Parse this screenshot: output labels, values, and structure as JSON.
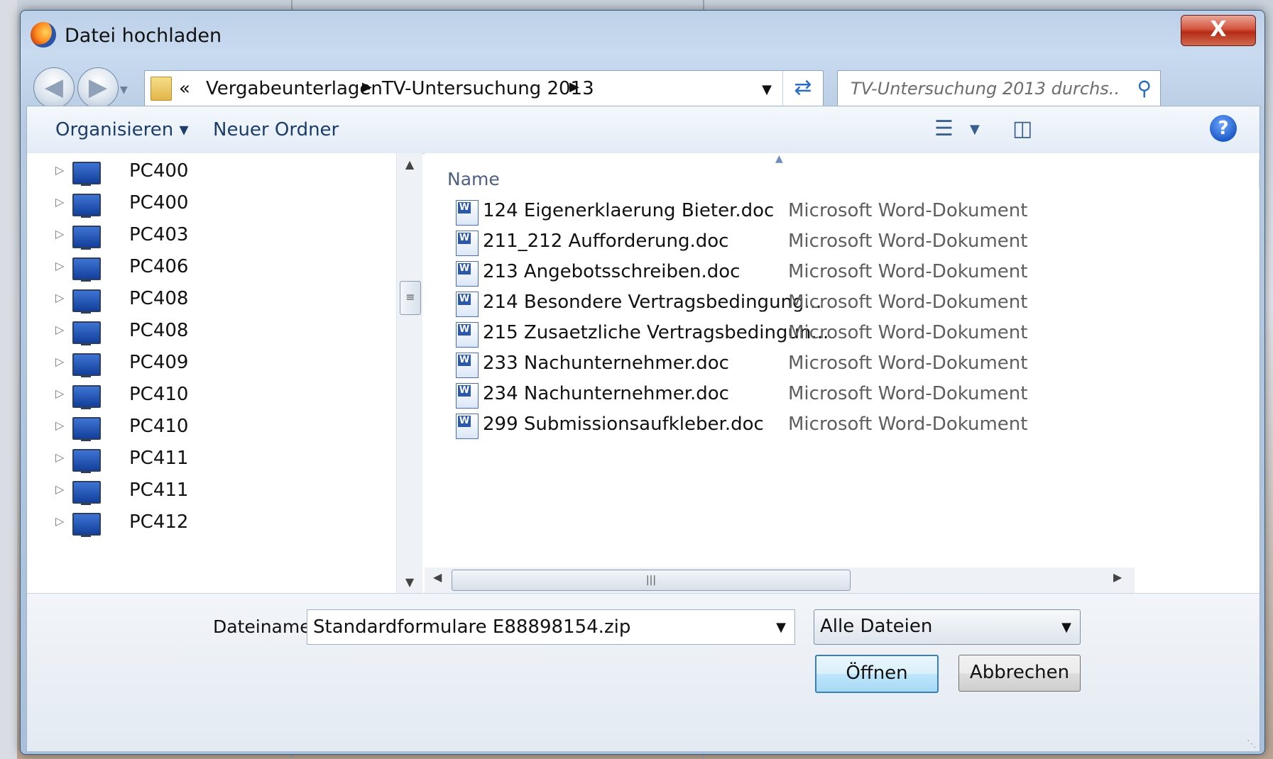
{
  "window": {
    "title": "Datei hochladen",
    "close_label": "X"
  },
  "navigation": {
    "back_icon": "back-arrow-icon",
    "forward_icon": "forward-arrow-icon",
    "overflow": "«",
    "breadcrumb": [
      "Vergabeunterlagen",
      "TV-Untersuchung 2013"
    ],
    "search_placeholder": "TV-Untersuchung 2013 durchs..."
  },
  "toolbar": {
    "organize_label": "Organisieren ▾",
    "new_folder_label": "Neuer Ordner"
  },
  "tree": {
    "items": [
      "PC400",
      "PC400",
      "PC403",
      "PC406",
      "PC408",
      "PC408",
      "PC409",
      "PC410",
      "PC410",
      "PC411",
      "PC411",
      "PC412"
    ]
  },
  "filelist": {
    "column_name": "Name",
    "files": [
      {
        "name": "124 Eigenerklaerung Bieter.doc",
        "type": "Microsoft Word-Dokument"
      },
      {
        "name": "211_212 Aufforderung.doc",
        "type": "Microsoft Word-Dokument"
      },
      {
        "name": "213 Angebotsschreiben.doc",
        "type": "Microsoft Word-Dokument"
      },
      {
        "name": "214 Besondere Vertragsbedingung...",
        "type": "Microsoft Word-Dokument"
      },
      {
        "name": "215 Zusaetzliche Vertragsbedingun...",
        "type": "Microsoft Word-Dokument"
      },
      {
        "name": "233 Nachunternehmer.doc",
        "type": "Microsoft Word-Dokument"
      },
      {
        "name": "234 Nachunternehmer.doc",
        "type": "Microsoft Word-Dokument"
      },
      {
        "name": "299 Submissionsaufkleber.doc",
        "type": "Microsoft Word-Dokument"
      }
    ]
  },
  "bottom": {
    "filename_label": "Dateiname:",
    "filename_value": "Standardformulare E88898154.zip",
    "filter_value": "Alle Dateien",
    "open_label": "Öffnen",
    "cancel_label": "Abbrechen"
  },
  "colors": {
    "accent": "#2a6cc8",
    "title_bar": "#bcd0e8",
    "close_button": "#c7432c"
  }
}
